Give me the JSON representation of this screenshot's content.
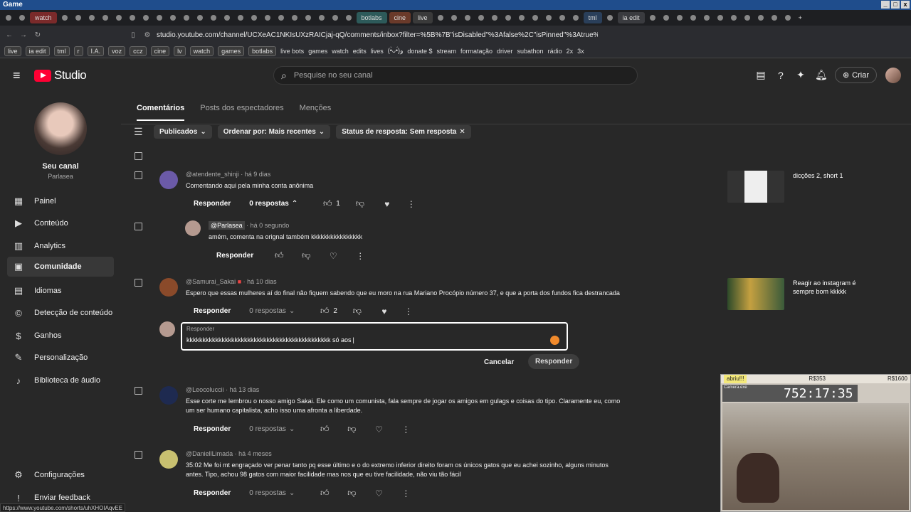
{
  "os": {
    "title": "Game"
  },
  "browser": {
    "tabs": [
      "watch",
      "botlabs",
      "cine",
      "live",
      "tml",
      "ia edit"
    ],
    "url": "studio.youtube.com/channel/UCXeAC1NKIsUXzRAICjaj-qQ/comments/inbox?filter=%5B%7B\"isDisabled\"%3Afalse%2C\"isPinned\"%3Atrue%2C\"nam...",
    "bookmarks_chips": [
      "live",
      "ia edit",
      "tml",
      "r",
      "I.A.",
      "voz",
      "ccz",
      "cine",
      "lv",
      "watch",
      "games",
      "botlabs"
    ],
    "bookmarks_items": [
      "live bots",
      "games",
      "watch",
      "edits",
      "lives",
      "(•̀ᴗ•́)و",
      "donate $",
      "stream",
      "formatação",
      "driver",
      "subathon",
      "rádio",
      "2x",
      "3x"
    ]
  },
  "header": {
    "studio_label": "Studio",
    "search_placeholder": "Pesquise no seu canal",
    "create_label": "Criar"
  },
  "sidebar": {
    "channel_title": "Seu canal",
    "channel_handle": "Parlasea",
    "items": [
      {
        "label": "Painel",
        "icon": "dashboard-icon"
      },
      {
        "label": "Conteúdo",
        "icon": "content-icon"
      },
      {
        "label": "Analytics",
        "icon": "analytics-icon"
      },
      {
        "label": "Comunidade",
        "icon": "community-icon"
      },
      {
        "label": "Idiomas",
        "icon": "languages-icon"
      },
      {
        "label": "Detecção de conteúdo",
        "icon": "copyright-icon"
      },
      {
        "label": "Ganhos",
        "icon": "earn-icon"
      },
      {
        "label": "Personalização",
        "icon": "customization-icon"
      },
      {
        "label": "Biblioteca de áudio",
        "icon": "audio-library-icon"
      }
    ],
    "settings": "Configurações",
    "feedback": "Enviar feedback"
  },
  "tabs": [
    "Comentários",
    "Posts dos espectadores",
    "Menções"
  ],
  "filters": [
    "Publicados",
    "Ordenar por: Mais recentes",
    "Status de resposta: Sem resposta"
  ],
  "comments": [
    {
      "handle": "@atendente_shinji",
      "time": "há 9 dias",
      "text": "Comentando aqui pela minha conta anônima",
      "reply": "Responder",
      "replies": "0 respostas",
      "likes": "1",
      "video": "dicções 2, short 1"
    },
    {
      "handle": "@Parlasea",
      "time": "há 0 segundo",
      "text": "amém, comenta na orignal também kkkkkkkkkkkkkkkk",
      "reply": "Responder"
    },
    {
      "handle": "@Samurai_Sakai",
      "time": "há 10 dias",
      "text": "Espero que essas mulheres aí do final não fiquem sabendo que eu moro na rua Mariano Procópio número 37, e que a porta dos fundos fica destrancada",
      "reply": "Responder",
      "replies": "0 respostas",
      "likes": "2",
      "video": "Reagir ao instagram é sempre bom kkkkk"
    },
    {
      "handle": "@Leocoluccii",
      "time": "há 13 dias",
      "text": "Esse corte me lembrou o nosso amigo Sakai. Ele como um comunista, fala sempre de jogar os amigos em gulags e coisas do tipo. Claramente eu, como um ser humano capitalista, acho isso uma afronta a liberdade.",
      "reply": "Responder",
      "replies": "0 respostas"
    },
    {
      "handle": "@DaniellLimada",
      "time": "há 4 meses",
      "text": "35:02 Me foi mt engraçado ver penar tanto pq esse último e o do extremo inferior direito foram os únicos gatos que eu achei sozinho, alguns minutos antes. Tipo, achou 98 gatos com maior facilidade mas nos que eu tive facilidade, não viu tão fácil",
      "reply": "Responder",
      "replies": "0 respostas"
    }
  ],
  "reply_box": {
    "label": "Responder",
    "value": "kkkkkkkkkkkkkkkkkkkkkkkkkkkkkkkkkkkkkkkkkkkkk só aos",
    "cancel": "Cancelar",
    "submit": "Responder"
  },
  "overlay": {
    "left": "abriu!!!",
    "mid": "R$353",
    "right": "R$1600",
    "cam": "Camera.exe",
    "timer": "752:17:35"
  },
  "status_url": "https://www.youtube.com/shorts/uhXHOIAqvEE"
}
